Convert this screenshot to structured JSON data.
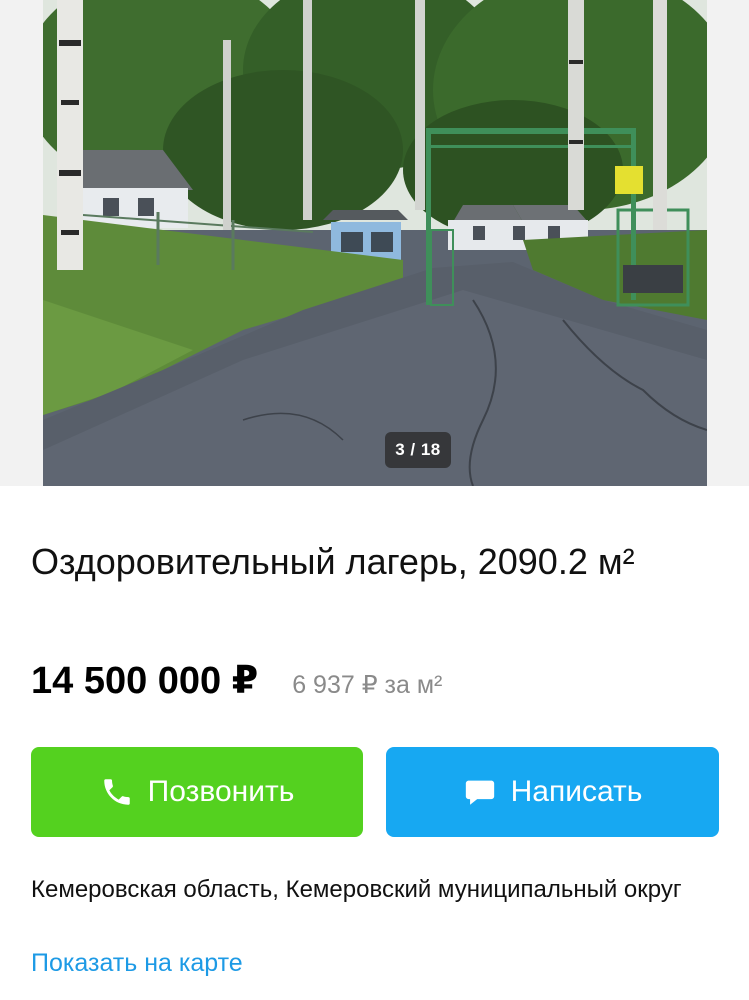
{
  "gallery": {
    "counter": "3 / 18",
    "colors": {
      "sky": "#dfe6de",
      "trees": "#3c6a2e",
      "asphalt": "#585f6a",
      "grass": "#5e8b3a"
    }
  },
  "listing": {
    "title": "Оздоровительный лагерь, 2090.2 м²",
    "price": "14 500 000 ₽",
    "price_per_m2": "6 937 ₽ за м²"
  },
  "actions": {
    "call_label": "Позвонить",
    "call_icon": "phone-icon",
    "call_color": "#54d11f",
    "write_label": "Написать",
    "write_icon": "chat-bubble-icon",
    "write_color": "#17a8f2"
  },
  "location": {
    "address": "Кемеровская область, Кемеровский муниципальный округ",
    "map_link": "Показать на карте",
    "link_color": "#1d9ae5"
  }
}
